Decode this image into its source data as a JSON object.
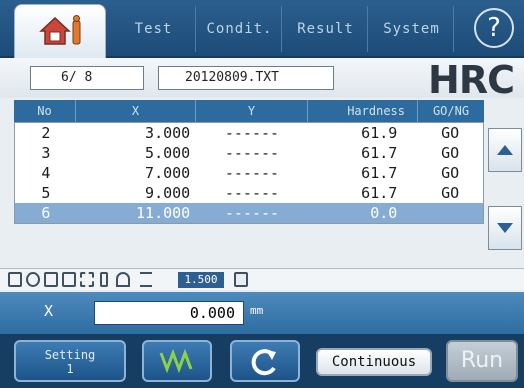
{
  "tabs": [
    {
      "label": "Test"
    },
    {
      "label": "Condit."
    },
    {
      "label": "Result"
    },
    {
      "label": "System"
    }
  ],
  "help_symbol": "?",
  "file": {
    "position": "6/ 8",
    "filename": "20120809.TXT",
    "scale": "HRC"
  },
  "table": {
    "headers": [
      "No",
      "X",
      "Y",
      "Hardness",
      "GO/NG"
    ],
    "rows": [
      {
        "no": "2",
        "x": "3.000",
        "y": "------",
        "hardness": "61.9",
        "gong": "GO"
      },
      {
        "no": "3",
        "x": "5.000",
        "y": "------",
        "hardness": "61.7",
        "gong": "GO"
      },
      {
        "no": "4",
        "x": "7.000",
        "y": "------",
        "hardness": "61.7",
        "gong": "GO"
      },
      {
        "no": "5",
        "x": "9.000",
        "y": "------",
        "hardness": "61.7",
        "gong": "GO"
      },
      {
        "no": "6",
        "x": "11.000",
        "y": "------",
        "hardness": "0.0",
        "gong": ""
      }
    ],
    "selected_row": 4
  },
  "status": {
    "zoom": "1.500"
  },
  "xfield": {
    "label": "X",
    "value": "0.000",
    "unit": "mm"
  },
  "bottom": {
    "setting_label": "Setting",
    "setting_sub": "1",
    "continuous_label": "Continuous",
    "run_label": "Run"
  },
  "colors": {
    "accent": "#2d6b9e",
    "selection": "#86acd4",
    "bar": "#163e63"
  }
}
